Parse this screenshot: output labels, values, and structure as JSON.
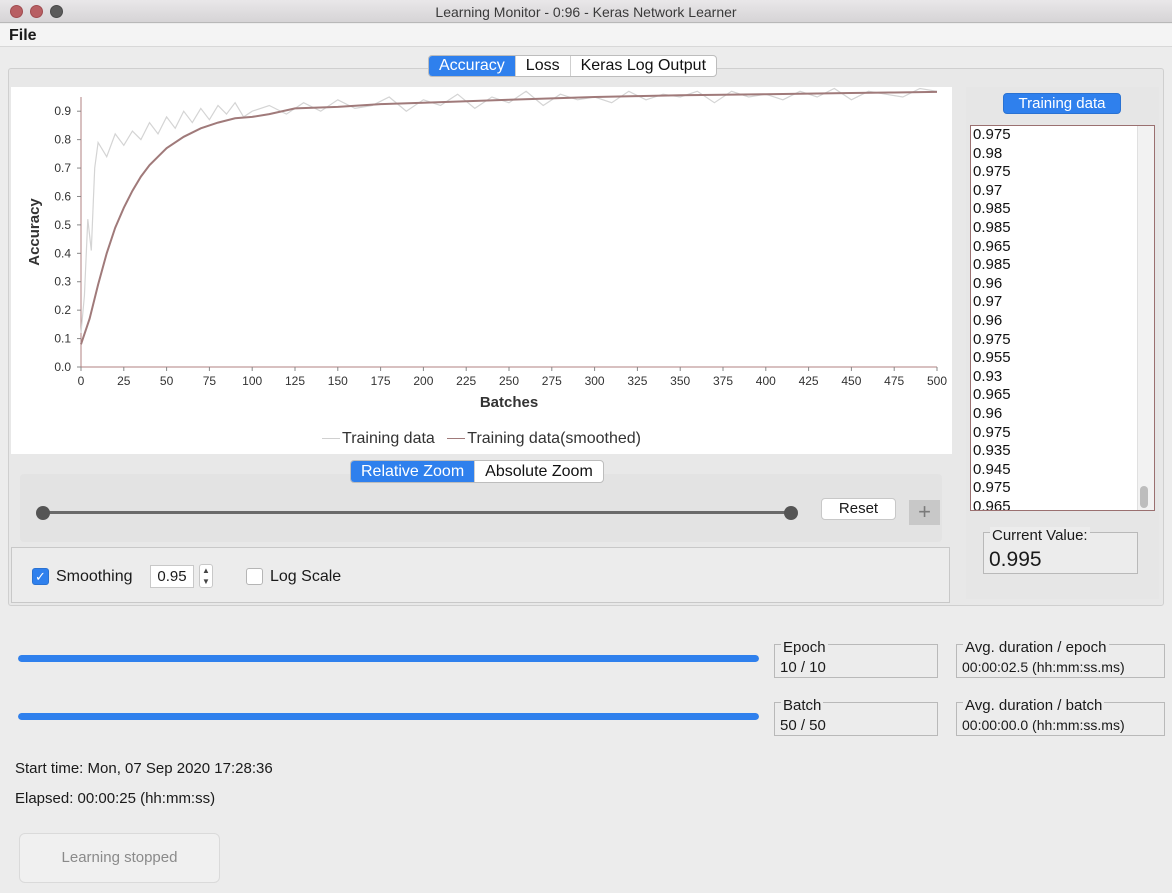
{
  "window": {
    "title": "Learning Monitor - 0:96 - Keras Network Learner"
  },
  "menu": {
    "file": "File"
  },
  "tabs": [
    {
      "label": "Accuracy",
      "active": true
    },
    {
      "label": "Loss",
      "active": false
    },
    {
      "label": "Keras Log Output",
      "active": false
    }
  ],
  "chart_data": {
    "type": "line",
    "xlabel": "Batches",
    "ylabel": "Accuracy",
    "xlim": [
      0,
      500
    ],
    "ylim": [
      0.0,
      0.95
    ],
    "xticks": [
      0,
      25,
      50,
      75,
      100,
      125,
      150,
      175,
      200,
      225,
      250,
      275,
      300,
      325,
      350,
      375,
      400,
      425,
      450,
      475,
      500
    ],
    "yticks": [
      "0.0",
      "0.1",
      "0.2",
      "0.3",
      "0.4",
      "0.5",
      "0.6",
      "0.7",
      "0.8",
      "0.9"
    ],
    "legend_position": "bottom-center",
    "series": [
      {
        "name": "Training data",
        "color": "#d4d4d4",
        "x": [
          0,
          2,
          4,
          6,
          8,
          10,
          15,
          20,
          25,
          30,
          35,
          40,
          45,
          50,
          55,
          60,
          65,
          70,
          75,
          80,
          85,
          90,
          95,
          100,
          110,
          120,
          130,
          140,
          150,
          160,
          170,
          180,
          190,
          200,
          210,
          220,
          230,
          240,
          250,
          260,
          270,
          280,
          290,
          300,
          310,
          320,
          330,
          340,
          350,
          360,
          370,
          380,
          390,
          400,
          410,
          420,
          430,
          440,
          450,
          460,
          470,
          480,
          490,
          500
        ],
        "y": [
          0.12,
          0.25,
          0.52,
          0.41,
          0.7,
          0.79,
          0.74,
          0.82,
          0.78,
          0.83,
          0.8,
          0.86,
          0.82,
          0.88,
          0.84,
          0.9,
          0.86,
          0.91,
          0.87,
          0.92,
          0.89,
          0.93,
          0.88,
          0.9,
          0.92,
          0.89,
          0.93,
          0.9,
          0.94,
          0.91,
          0.92,
          0.95,
          0.9,
          0.94,
          0.92,
          0.96,
          0.91,
          0.95,
          0.93,
          0.97,
          0.92,
          0.96,
          0.94,
          0.95,
          0.93,
          0.97,
          0.94,
          0.96,
          0.95,
          0.97,
          0.93,
          0.97,
          0.95,
          0.96,
          0.94,
          0.97,
          0.95,
          0.98,
          0.94,
          0.97,
          0.96,
          0.95,
          0.98,
          0.97
        ]
      },
      {
        "name": "Training data(smoothed)",
        "color": "#a07a7a",
        "x": [
          0,
          5,
          10,
          15,
          20,
          25,
          30,
          35,
          40,
          45,
          50,
          60,
          70,
          80,
          90,
          100,
          110,
          125,
          150,
          175,
          200,
          225,
          250,
          275,
          300,
          325,
          350,
          375,
          400,
          425,
          450,
          475,
          500
        ],
        "y": [
          0.08,
          0.17,
          0.29,
          0.4,
          0.49,
          0.56,
          0.62,
          0.67,
          0.71,
          0.74,
          0.77,
          0.81,
          0.84,
          0.86,
          0.875,
          0.88,
          0.89,
          0.91,
          0.915,
          0.925,
          0.93,
          0.935,
          0.94,
          0.945,
          0.95,
          0.953,
          0.956,
          0.958,
          0.96,
          0.962,
          0.964,
          0.966,
          0.968
        ]
      }
    ]
  },
  "zoom": {
    "tabs": [
      {
        "label": "Relative Zoom",
        "active": true
      },
      {
        "label": "Absolute Zoom",
        "active": false
      }
    ],
    "reset_label": "Reset",
    "plus_label": "+"
  },
  "options": {
    "smoothing_label": "Smoothing",
    "smoothing_checked": true,
    "smoothing_value": "0.95",
    "log_scale_label": "Log Scale",
    "log_scale_checked": false
  },
  "training_data_panel": {
    "button_label": "Training data",
    "values": [
      "0.975",
      "0.98",
      "0.975",
      "0.97",
      "0.985",
      "0.985",
      "0.965",
      "0.985",
      "0.96",
      "0.97",
      "0.96",
      "0.975",
      "0.955",
      "0.93",
      "0.965",
      "0.96",
      "0.975",
      "0.935",
      "0.945",
      "0.975",
      "0.965"
    ],
    "current_value_label": "Current Value:",
    "current_value": "0.995"
  },
  "progress": {
    "epoch_label": "Epoch",
    "epoch_value": "10 / 10",
    "epoch_fraction": 1.0,
    "batch_label": "Batch",
    "batch_value": "50 / 50",
    "batch_fraction": 1.0,
    "avg_epoch_label": "Avg. duration / epoch",
    "avg_epoch_value": "00:00:02.5 (hh:mm:ss.ms)",
    "avg_batch_label": "Avg. duration / batch",
    "avg_batch_value": "00:00:00.0 (hh:mm:ss.ms)"
  },
  "status": {
    "start_time": "Start time: Mon, 07 Sep 2020 17:28:36",
    "elapsed": "Elapsed: 00:00:25 (hh:mm:ss)",
    "button_label": "Learning stopped"
  },
  "colors": {
    "accent": "#2f80ed",
    "smoothed_line": "#a07a7a",
    "raw_line": "#d4d4d4"
  }
}
